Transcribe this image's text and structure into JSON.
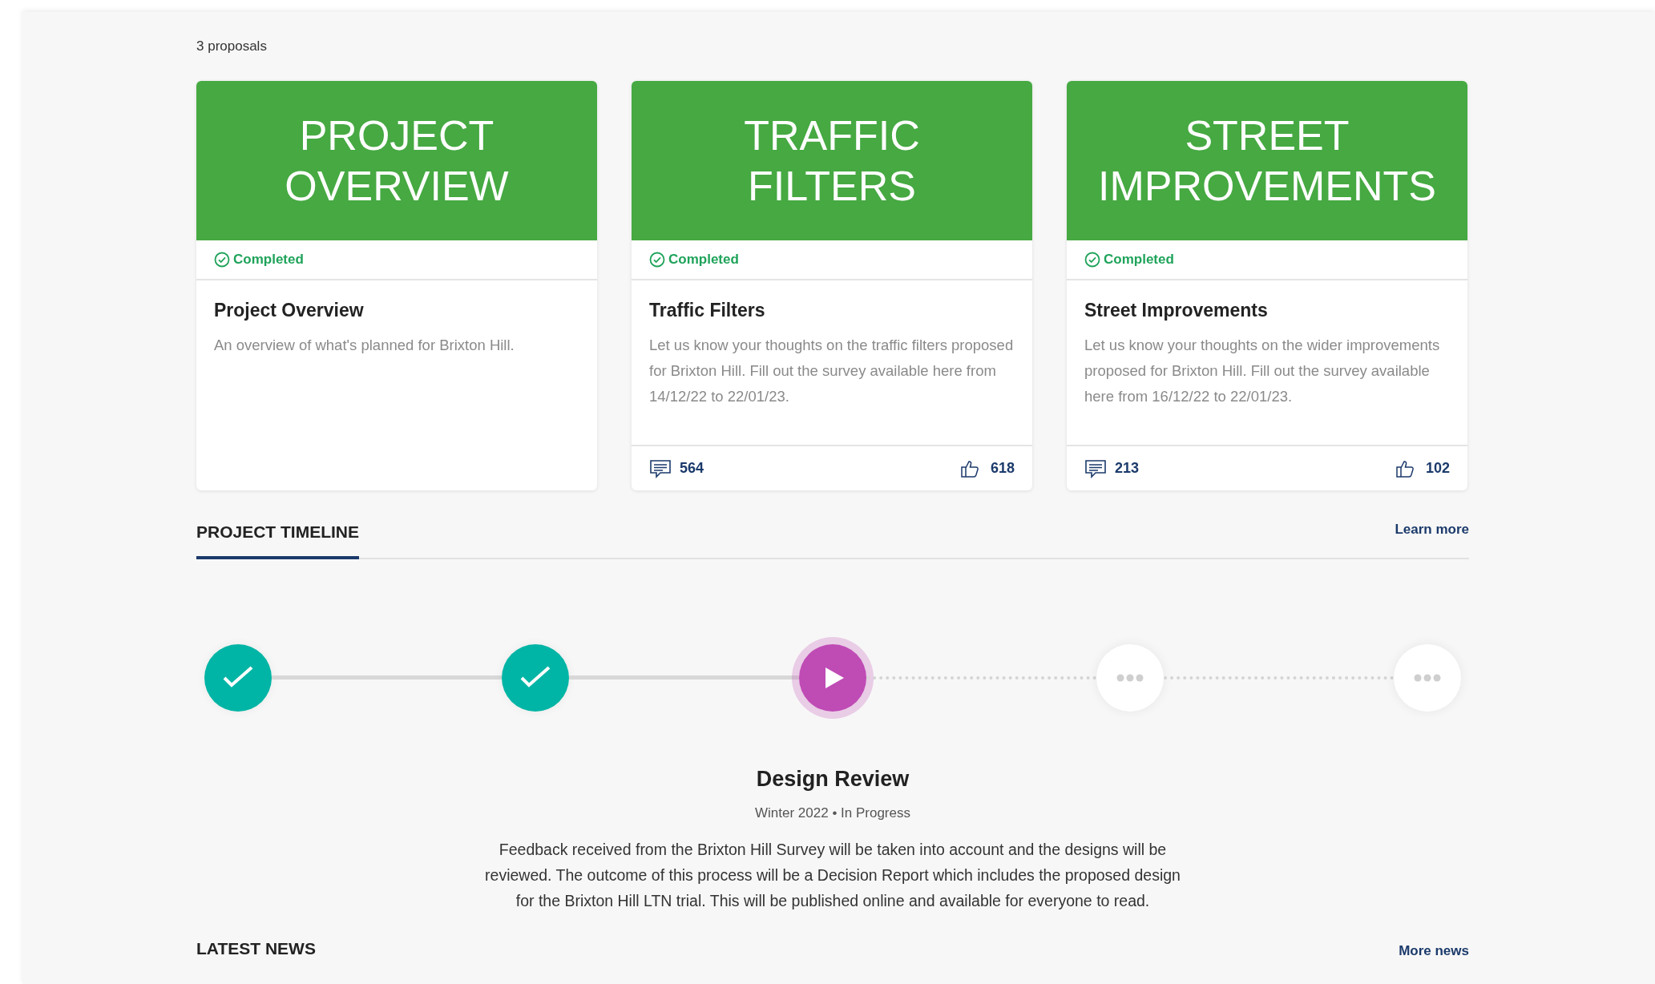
{
  "proposals_count": "3 proposals",
  "cards": [
    {
      "heading": "PROJECT OVERVIEW",
      "status": "Completed",
      "title": "Project Overview",
      "description": "An overview of what's planned for Brixton Hill."
    },
    {
      "heading": "TRAFFIC FILTERS",
      "status": "Completed",
      "title": "Traffic Filters",
      "description": "Let us know your thoughts on the traffic filters proposed for Brixton Hill. Fill out the survey available here from 14/12/22 to 22/01/23.",
      "comments": "564",
      "likes": "618"
    },
    {
      "heading": "STREET IMPROVEMENTS",
      "status": "Completed",
      "title": "Street Improvements",
      "description": "Let us know your thoughts on the wider improvements proposed for Brixton Hill. Fill out the survey available here from 16/12/22 to 22/01/23.",
      "comments": "213",
      "likes": "102"
    }
  ],
  "timeline_tab": {
    "label": "PROJECT TIMELINE",
    "selected": true
  },
  "learn_more": "Learn more",
  "timeline": {
    "steps": [
      {
        "kind": "done",
        "selected": false
      },
      {
        "kind": "done",
        "selected": false
      },
      {
        "kind": "current",
        "selected": true
      },
      {
        "kind": "upcoming",
        "selected": false
      },
      {
        "kind": "upcoming",
        "selected": false
      }
    ],
    "detail": {
      "title": "Design Review",
      "meta": "Winter 2022 • In Progress",
      "description": "Feedback received from the Brixton Hill Survey will be taken into account and the designs will be reviewed. The outcome of this process will be a Decision Report which includes the proposed design for the Brixton Hill LTN trial. This will be published online and available for everyone to read."
    }
  },
  "latest_news": "LATEST NEWS",
  "more_news": "More news"
}
